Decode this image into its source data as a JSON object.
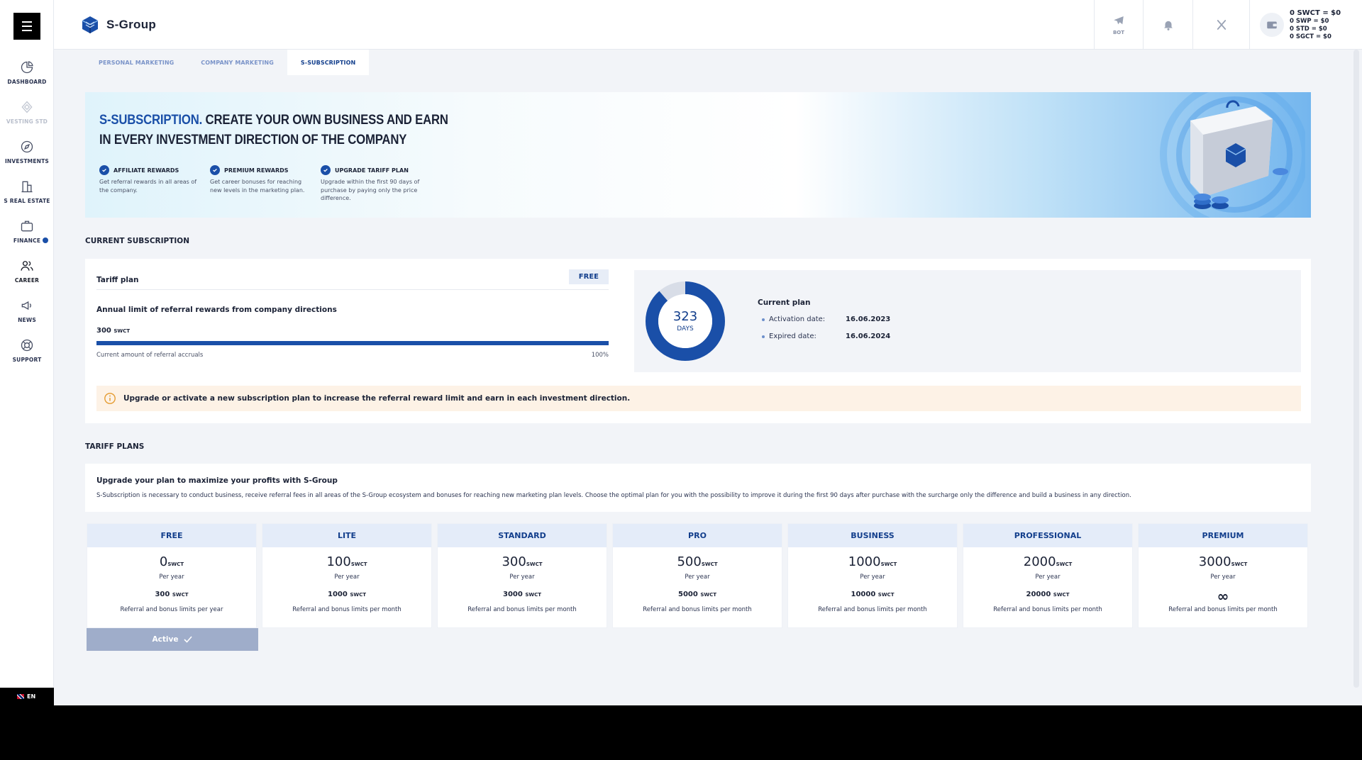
{
  "app": {
    "name": "S-Group"
  },
  "sidebar": {
    "items": [
      {
        "label": "DASHBOARD",
        "icon": "chart-pie-icon"
      },
      {
        "label": "VESTING STD",
        "icon": "diamond-icon"
      },
      {
        "label": "INVESTMENTS",
        "icon": "compass-icon"
      },
      {
        "label": "S REAL ESTATE",
        "icon": "building-icon"
      },
      {
        "label": "FINANCE",
        "icon": "briefcase-icon"
      },
      {
        "label": "CAREER",
        "icon": "users-icon"
      },
      {
        "label": "NEWS",
        "icon": "megaphone-icon"
      },
      {
        "label": "SUPPORT",
        "icon": "lifebuoy-icon"
      }
    ],
    "language": "EN"
  },
  "header": {
    "bot_label": "BOT",
    "balances": [
      "0 SWCT = $0",
      "0 SWP = $0",
      "0 STD = $0",
      "0 SGCT = $0"
    ]
  },
  "tabs": [
    {
      "label": "PERSONAL MARKETING"
    },
    {
      "label": "COMPANY MARKETING"
    },
    {
      "label": "S-SUBSCRIPTION"
    }
  ],
  "banner": {
    "title_accent": "S-SUBSCRIPTION.",
    "title_rest": " CREATE YOUR OWN BUSINESS AND EARN IN EVERY INVESTMENT DIRECTION OF THE COMPANY",
    "features": [
      {
        "title": "AFFILIATE REWARDS",
        "text": "Get referral rewards in all areas of the company."
      },
      {
        "title": "PREMIUM REWARDS",
        "text": "Get career bonuses for reaching new levels in the marketing plan."
      },
      {
        "title": "UPGRADE TARIFF PLAN",
        "text": "Upgrade within the first 90 days of purchase by paying only the price difference."
      }
    ]
  },
  "current": {
    "section_title": "CURRENT SUBSCRIPTION",
    "tariff_label": "Tariff plan",
    "plan_badge": "FREE",
    "limit_title": "Annual limit of referral rewards from company directions",
    "limit_value": "300",
    "limit_unit": "SWCT",
    "progress_fraction": 1.0,
    "progress_caption": "Current amount of referral accruals",
    "progress_percent": "100%",
    "days_left": "323",
    "days_label": "DAYS",
    "days_fraction": 0.885,
    "plan_title": "Current plan",
    "activation_label": "Activation date:",
    "activation_date": "16.06.2023",
    "expired_label": "Expired date:",
    "expired_date": "16.06.2024",
    "alert": "Upgrade or activate a new subscription plan to increase the referral reward limit and earn in each investment direction."
  },
  "plans_section": {
    "title": "TARIFF PLANS",
    "intro_title": "Upgrade your plan to maximize your profits with S-Group",
    "intro_text": "S-Subscription is necessary to conduct business, receive referral fees in all areas of the S-Group ecosystem and bonuses for reaching new marketing plan levels. Choose the optimal plan for you with the possibility to improve it during the first 90 days after purchase with the surcharge only the difference and build a business in any direction.",
    "unit": "SWCT",
    "per_year": "Per year",
    "plans": [
      {
        "name": "FREE",
        "price": "0",
        "limit": "300",
        "desc": "Referral and bonus limits per year"
      },
      {
        "name": "LITE",
        "price": "100",
        "limit": "1000",
        "desc": "Referral and bonus limits per month"
      },
      {
        "name": "STANDARD",
        "price": "300",
        "limit": "3000",
        "desc": "Referral and bonus limits per month"
      },
      {
        "name": "PRO",
        "price": "500",
        "limit": "5000",
        "desc": "Referral and bonus limits per month"
      },
      {
        "name": "BUSINESS",
        "price": "1000",
        "limit": "10000",
        "desc": "Referral and bonus limits per month"
      },
      {
        "name": "PROFESSIONAL",
        "price": "2000",
        "limit": "20000",
        "desc": "Referral and bonus limits per month"
      },
      {
        "name": "PREMIUM",
        "price": "3000",
        "limit": "∞",
        "desc": "Referral and bonus limits per month"
      }
    ],
    "active_label": "Active"
  },
  "colors": {
    "accent": "#1a4fa8",
    "dark": "#123e8c",
    "alert_bg": "#fdf2e6"
  }
}
